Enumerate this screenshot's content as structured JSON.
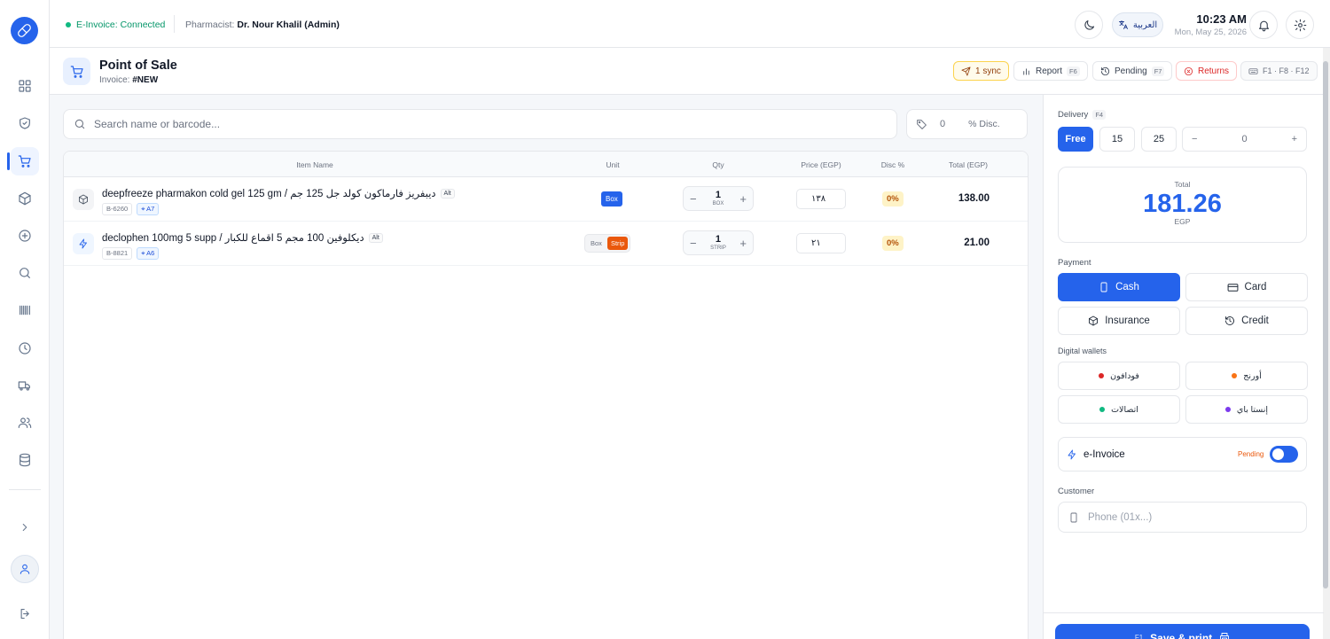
{
  "topbar": {
    "einvoice_status": "E-Invoice: Connected",
    "pharmacist_label": "Pharmacist:",
    "pharmacist_name": "Dr. Nour Khalil (Admin)",
    "language_label": "العربية",
    "time": "10:23 AM",
    "date": "Mon, May 25, 2026"
  },
  "header": {
    "title": "Point of Sale",
    "invoice_label": "Invoice:",
    "invoice_number": "#NEW",
    "sync_label": "1 sync",
    "report_label": "Report",
    "report_key": "F6",
    "pending_label": "Pending",
    "pending_key": "F7",
    "returns_label": "Returns",
    "shortcuts_label": "F1 · F8 · F12"
  },
  "search": {
    "placeholder": "Search name or barcode...",
    "discount_value": "0",
    "discount_label": "% Disc."
  },
  "table": {
    "columns": [
      "Item Name",
      "Unit",
      "Qty",
      "Price (EGP)",
      "Disc %",
      "Total (EGP)"
    ],
    "rows": [
      {
        "name": "deepfreeze pharmakon cold gel 125 gm / ديبفريز فارماكون كولد جل 125 جم",
        "alt_badge": "Alt",
        "code": "B-6260",
        "location": "⌖ A7",
        "units": [
          "Box"
        ],
        "qty": "1",
        "qty_unit": "BOX",
        "price": "١٣٨",
        "discount": "0%",
        "total": "138.00"
      },
      {
        "name": "declophen 100mg 5 supp / ديكلوفين 100 مجم 5 اقماع للكبار",
        "alt_badge": "Alt",
        "code": "B-8821",
        "location": "⌖ A6",
        "units": [
          "Box",
          "Strip"
        ],
        "qty": "1",
        "qty_unit": "STRIP",
        "price": "٢١",
        "discount": "0%",
        "total": "21.00"
      }
    ]
  },
  "panel": {
    "delivery_label": "Delivery",
    "delivery_key": "F4",
    "delivery_options": [
      "Free",
      "15",
      "25"
    ],
    "delivery_custom": "0",
    "total_label": "Total",
    "total_value": "181.26",
    "currency": "EGP",
    "payment_label": "Payment",
    "payment_methods": [
      "Cash",
      "Card",
      "Insurance",
      "Credit"
    ],
    "wallets_label": "Digital wallets",
    "wallets": [
      {
        "name": "فودافون",
        "color": "#dc2626"
      },
      {
        "name": "أورنج",
        "color": "#f97316"
      },
      {
        "name": "اتصالات",
        "color": "#10b981"
      },
      {
        "name": "إنستا باي",
        "color": "#7c3aed"
      }
    ],
    "einvoice_label": "e-Invoice",
    "einvoice_status": "Pending",
    "customer_label": "Customer",
    "phone_placeholder": "Phone (01x...)",
    "save_key": "F1",
    "save_label": "Save & print"
  },
  "colors": {
    "accent": "#2563eb",
    "success": "#10b981",
    "warning": "#ea580c",
    "danger": "#dc2626"
  }
}
